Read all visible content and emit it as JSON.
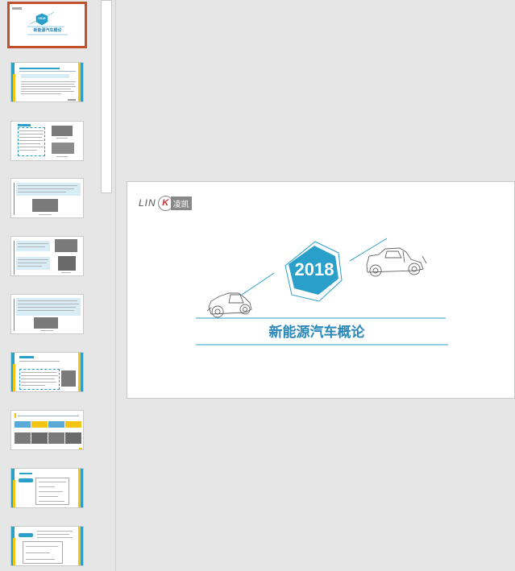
{
  "thumbnails": {
    "count": 10,
    "selected_index": 1,
    "first": {
      "year": "2018",
      "title": "新能源汽车概论"
    }
  },
  "slide": {
    "logo": {
      "lin": "LIN",
      "k": "K",
      "cn": "凌凯"
    },
    "year": "2018",
    "title": "新能源汽车概论"
  },
  "colors": {
    "accent": "#2a9fc9",
    "title": "#2a87b8",
    "highlight_border": "#c0502b",
    "yellow": "#f5c311"
  }
}
